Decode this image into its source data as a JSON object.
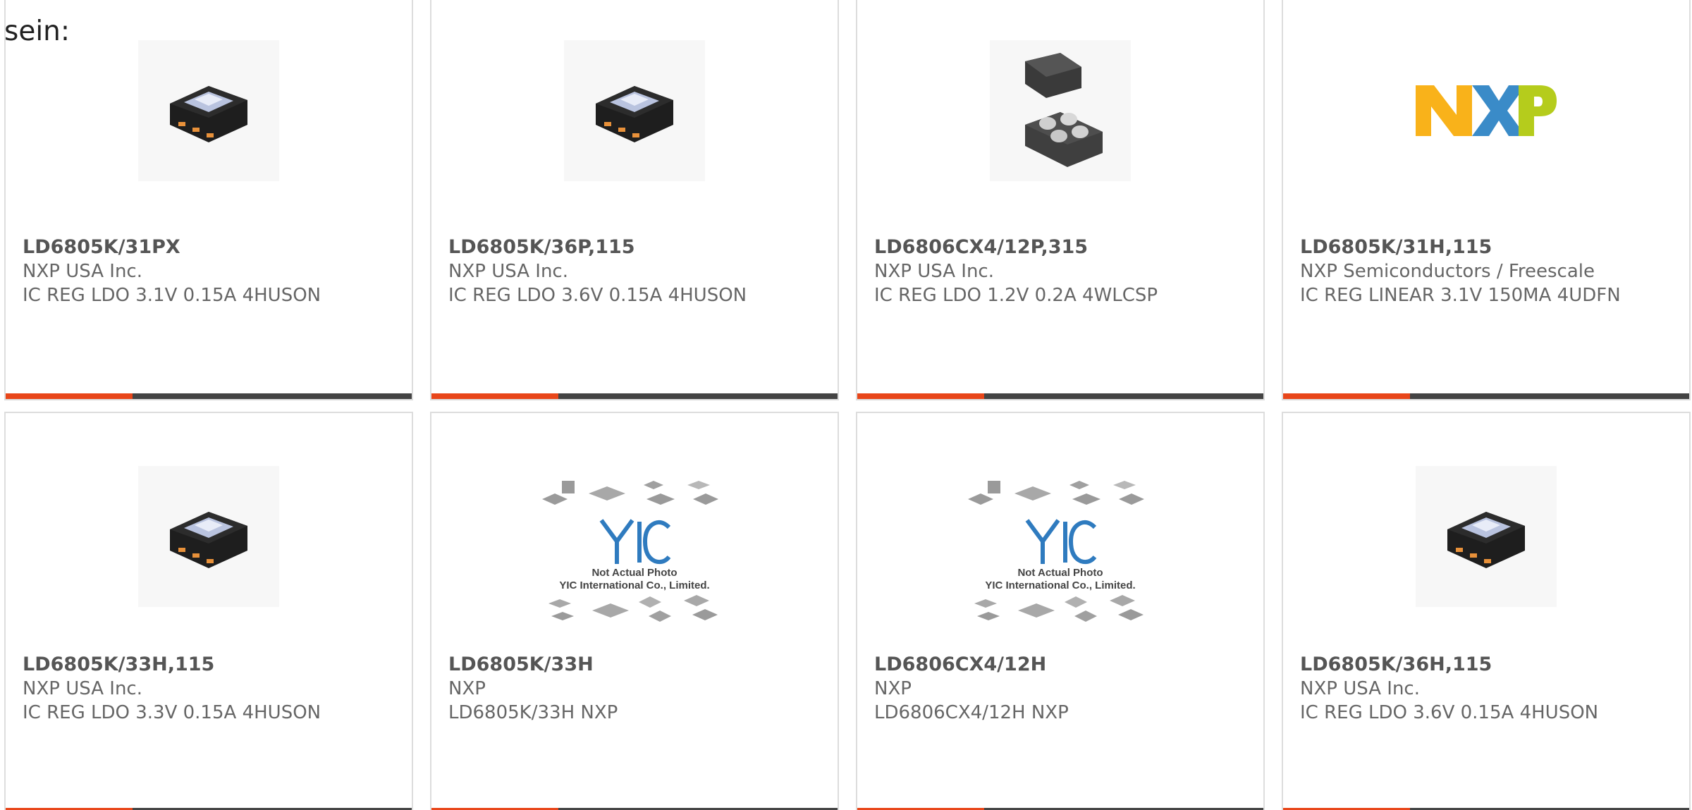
{
  "intro_text": "sein:",
  "colors": {
    "accent": "#e8461a",
    "bar_dark": "#444444",
    "nxp_yellow": "#f9b21a",
    "nxp_blue": "#3a8bc8",
    "nxp_green": "#b5cc1c",
    "yic_blue": "#2f7bbf"
  },
  "products": [
    {
      "part": "LD6805K/31PX",
      "maker": "NXP USA Inc.",
      "desc": "IC REG LDO 3.1V 0.15A 4HUSON",
      "image": "huson-package-icon"
    },
    {
      "part": "LD6805K/36P,115",
      "maker": "NXP USA Inc.",
      "desc": "IC REG LDO 3.6V 0.15A 4HUSON",
      "image": "huson-package-icon"
    },
    {
      "part": "LD6806CX4/12P,315",
      "maker": "NXP USA Inc.",
      "desc": "IC REG LDO 1.2V 0.2A 4WLCSP",
      "image": "wlcsp-package-icon"
    },
    {
      "part": "LD6805K/31H,115",
      "maker": "NXP Semiconductors / Freescale",
      "desc": "IC REG LINEAR 3.1V 150MA 4UDFN",
      "image": "nxp-logo"
    },
    {
      "part": "LD6805K/33H,115",
      "maker": "NXP USA Inc.",
      "desc": "IC REG LDO 3.3V 0.15A 4HUSON",
      "image": "huson-package-icon"
    },
    {
      "part": "LD6805K/33H",
      "maker": "NXP",
      "desc": "LD6805K/33H NXP",
      "image": "yic-placeholder",
      "photo_note": "Not Actual Photo",
      "photo_company": "YIC International Co., Limited."
    },
    {
      "part": "LD6806CX4/12H",
      "maker": "NXP",
      "desc": "LD6806CX4/12H NXP",
      "image": "yic-placeholder",
      "photo_note": "Not Actual Photo",
      "photo_company": "YIC International Co., Limited."
    },
    {
      "part": "LD6805K/36H,115",
      "maker": "NXP USA Inc.",
      "desc": "IC REG LDO 3.6V 0.15A 4HUSON",
      "image": "huson-package-icon"
    }
  ]
}
